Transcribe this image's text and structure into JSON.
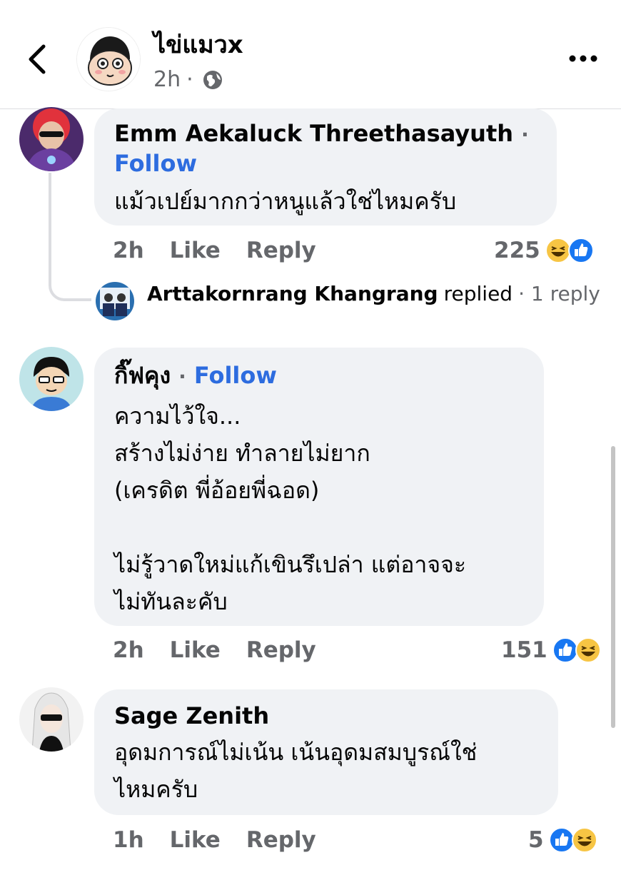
{
  "header": {
    "name": "ไข่แมวx",
    "time": "2h",
    "separator": "·"
  },
  "comments": [
    {
      "author": "Emm Aekaluck Threethasayuth",
      "follow": "Follow",
      "text": "แม้วเปย์มากกว่าหนูแล้วใช่ไหมครับ",
      "time": "2h",
      "like": "Like",
      "reply": "Reply",
      "reaction_count": "225",
      "reactions": [
        "haha",
        "like"
      ]
    },
    {
      "author": "กิ๊ฟคุง",
      "follow": "Follow",
      "text": "ความไว้ใจ...\nสร้างไม่ง่าย ทำลายไม่ยาก\n(เครดิต พี่อ้อยพี่ฉอด)\n\nไม่รู้วาดใหม่แก้เขินรึเปล่า แต่อาจจะ\nไม่ทันละคับ",
      "time": "2h",
      "like": "Like",
      "reply": "Reply",
      "reaction_count": "151",
      "reactions": [
        "like",
        "haha"
      ]
    },
    {
      "author": "Sage Zenith",
      "text": "อุดมการณ์ไม่เน้น เน้นอุดมสมบูรณ์ใช่\nไหมครับ",
      "time": "1h",
      "like": "Like",
      "reply": "Reply",
      "reaction_count": "5",
      "reactions": [
        "like",
        "haha"
      ]
    }
  ],
  "replied": {
    "name": "Arttakornrang Khangrang",
    "action": "replied",
    "count": "· 1 reply"
  },
  "colors": {
    "link": "#2d6cdf",
    "bubble": "#f0f2f5",
    "muted": "#65676b",
    "like": "#1877f2",
    "haha": "#f7c544"
  },
  "icons": [
    "back-arrow-icon",
    "more-icon",
    "globe-icon",
    "like-reaction-icon",
    "haha-reaction-icon"
  ]
}
